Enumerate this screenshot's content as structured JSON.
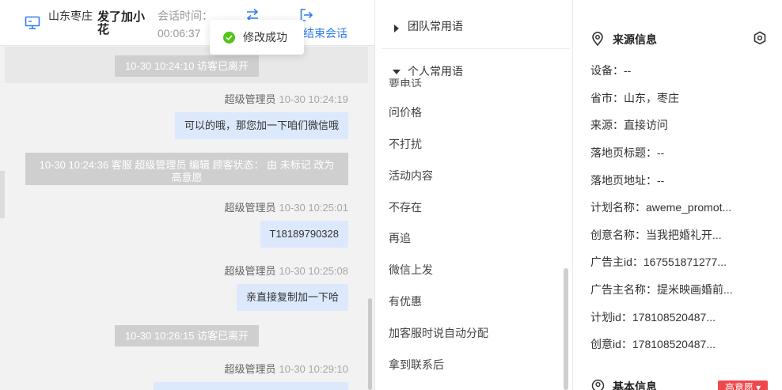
{
  "header": {
    "visitor_location": "山东枣庄",
    "visitor_name": "发了加小花",
    "session_label": "会话时间：",
    "session_time": "00:06:37",
    "end_label": "结束会话"
  },
  "toast": {
    "text": "修改成功",
    "icon": "check-circle-icon",
    "color": "#52c41a"
  },
  "chat": {
    "messages": [
      {
        "type": "system",
        "text": "10-30 10:24:10 访客已离开"
      },
      {
        "type": "agent",
        "sender": "超级管理员",
        "time": "10-30 10:24:19",
        "text": "可以的哦，那您加一下咱们微信哦"
      },
      {
        "type": "system",
        "text": "10-30 10:24:36 客服 超级管理员 编辑 顾客状态： 由 未标记 改为 高意愿"
      },
      {
        "type": "agent",
        "sender": "超级管理员",
        "time": "10-30 10:25:01",
        "text": "T18189790328"
      },
      {
        "type": "agent",
        "sender": "超级管理员",
        "time": "10-30 10:25:08",
        "text": "亲直接复制加一下哈"
      },
      {
        "type": "system",
        "text": "10-30 10:26:15 访客已离开"
      },
      {
        "type": "agent",
        "sender": "超级管理员",
        "time": "10-30 10:29:10",
        "text": ""
      }
    ],
    "bubble_color": "#dce8fb",
    "system_color": "#cfcfcf"
  },
  "phrases": {
    "team_group": "团队常用语",
    "personal_group": "个人常用语",
    "clipped_item": "要电话",
    "items": [
      "问价格",
      "不打扰",
      "活动内容",
      "不存在",
      "再追",
      "微信上发",
      "有优惠",
      "加客服时说自动分配",
      "拿到联系后"
    ]
  },
  "info": {
    "source_title": "来源信息",
    "rows": [
      "设备：--",
      "省市：山东，枣庄",
      "来源：直接访问",
      "落地页标题：--",
      "落地页地址：--",
      "计划名称：aweme_promot...",
      "创意名称：当我把婚礼开...",
      "广告主id：167551871277...",
      "广告主名称：提米映画婚前...",
      "计划id：178108520487...",
      "创意id：178108520487..."
    ],
    "basic_title": "基本信息",
    "intent_badge": "高意愿 ▾",
    "badge_color": "#f0474c"
  }
}
